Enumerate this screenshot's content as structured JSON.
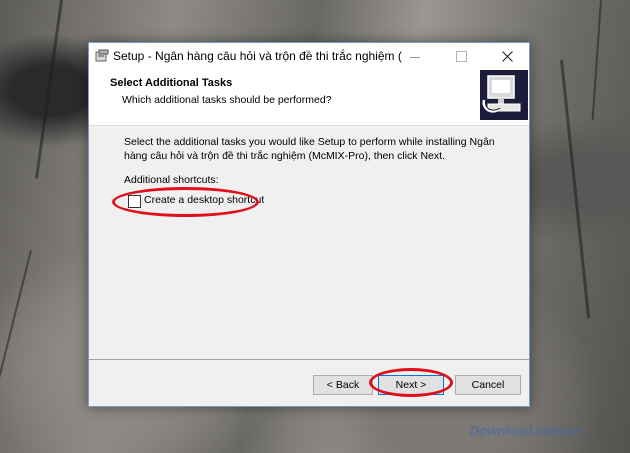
{
  "window": {
    "title": "Setup - Ngân hàng câu hỏi và trộn đề thi trắc nghiệm (...",
    "minimize_glyph": "—",
    "maximize_glyph": "☐",
    "close_glyph": "✕"
  },
  "header": {
    "title": "Select Additional Tasks",
    "subtitle": "Which additional tasks should be performed?"
  },
  "body": {
    "description": "Select the additional tasks you would like Setup to perform while installing Ngân hàng câu hỏi và trộn đề thi trắc nghiệm (McMIX-Pro), then click Next.",
    "shortcuts_label": "Additional shortcuts:",
    "checkbox_label": "Create a desktop shortcut",
    "checkbox_checked": false
  },
  "buttons": {
    "back": "< Back",
    "next": "Next >",
    "cancel": "Cancel"
  },
  "watermark": "Download.com.vn",
  "colors": {
    "highlight": "#e0101a",
    "focus_border": "#0078d7"
  }
}
